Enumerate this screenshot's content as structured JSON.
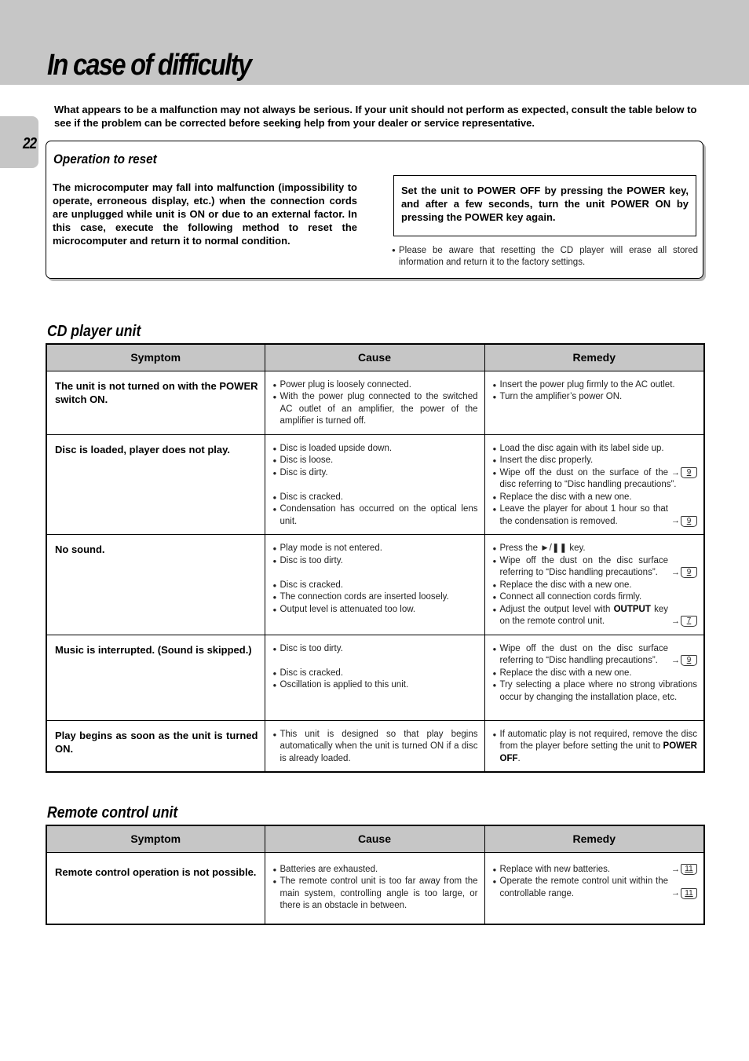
{
  "header": {
    "title": "In case of difficulty",
    "page_number": "22"
  },
  "intro": "What appears to be a malfunction may not always be serious. If your unit should not perform as expected, consult the table below to see if the problem can be corrected before seeking help from your dealer or service representative.",
  "reset": {
    "title": "Operation to reset",
    "description": "The microcomputer may fall into malfunction (impossibility to operate, erroneous display, etc.) when the connection cords are unplugged while unit is ON or due to an external factor. In this case, execute the following method to reset the microcomputer and return it to normal condition.",
    "instruction": "Set the unit to POWER OFF by pressing the POWER key, and after a few seconds, turn the unit POWER ON by pressing the POWER key again.",
    "note": "Please be aware that resetting the CD player will erase all stored information and return it to the factory settings."
  },
  "columns": {
    "symptom": "Symptom",
    "cause": "Cause",
    "remedy": "Remedy"
  },
  "cd_section": {
    "title": "CD player unit",
    "rows": [
      {
        "symptom": "The unit is not turned on with the POWER switch ON.",
        "causes": [
          "Power plug is loosely connected.",
          "With the power plug connected to the switched AC outlet of an amplifier, the power of the amplifier is turned off."
        ],
        "remedies": [
          "Insert the power plug firmly to the AC outlet.",
          "Turn the amplifier’s power ON."
        ]
      },
      {
        "symptom": "Disc is loaded, player does not play.",
        "causes": [
          "Disc is loaded upside down.",
          "Disc is loose.",
          "Disc is dirty.",
          "Disc is cracked.",
          "Condensation has occurred on the optical lens unit."
        ],
        "remedies": [
          "Load the disc again with its label side up.",
          "Insert the disc properly.",
          "Wipe off the dust on the surface of the disc referring to “Disc handling precautions”.",
          "Replace the disc with a new one.",
          "Leave the player for about 1 hour so that the condensation is removed."
        ],
        "remedy_refs": [
          "",
          "",
          "9",
          "",
          "9"
        ]
      },
      {
        "symptom": "No sound.",
        "causes": [
          "Play mode is not entered.",
          "Disc is too dirty.",
          "Disc is cracked.",
          "The connection cords are inserted loosely.",
          "Output level is attenuated too low."
        ],
        "remedies": [
          "Press the ►/❚❚ key.",
          "Wipe off the dust on the disc surface referring to “Disc handling precautions”.",
          "Replace the disc with a new one.",
          "Connect all connection cords firmly.",
          "Adjust the output level with",
          "OUTPUT",
          "key on the remote control unit."
        ],
        "remedy_refs": [
          "",
          "9",
          "",
          "",
          "7"
        ]
      },
      {
        "symptom": "Music is interrupted. (Sound is skipped.)",
        "causes": [
          "Disc is too dirty.",
          "Disc is cracked.",
          "Oscillation is applied to this unit."
        ],
        "remedies": [
          "Wipe off the dust on the disc surface referring to “Disc handling precautions”.",
          "Replace the disc with a new one.",
          "Try selecting a place where no strong vibrations occur by changing the installation place, etc."
        ],
        "remedy_refs": [
          "9",
          "",
          ""
        ]
      },
      {
        "symptom": "Play begins as soon as the unit is turned ON.",
        "causes": [
          "This unit is designed so that play begins automatically when the unit is turned ON if a disc is already loaded."
        ],
        "remedies": [
          "If automatic play is not required, remove the disc from the player before setting the unit to",
          "POWER OFF",
          "."
        ]
      }
    ]
  },
  "remote_section": {
    "title": "Remote control unit",
    "rows": [
      {
        "symptom": "Remote control operation is not possible.",
        "causes": [
          "Batteries are exhausted.",
          "The remote control unit is too far away from the main system, controlling angle is too large, or there is an obstacle in between."
        ],
        "remedies": [
          "Replace with new batteries.",
          "Operate the remote control unit within the controllable range."
        ],
        "remedy_refs": [
          "11",
          "11"
        ]
      }
    ]
  }
}
